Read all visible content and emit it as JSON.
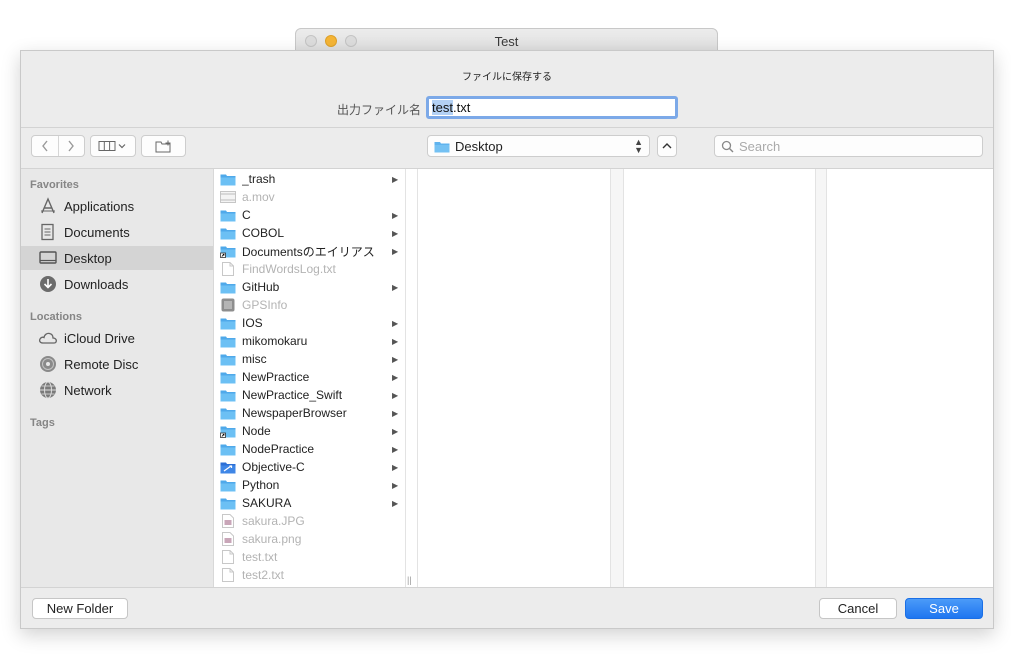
{
  "parent_window": {
    "title": "Test"
  },
  "sheet": {
    "message": "ファイルに保存する",
    "filename_label": "出力ファイル名",
    "filename_selected": "test",
    "filename_rest": ".txt"
  },
  "toolbar": {
    "location": "Desktop",
    "search_placeholder": "Search"
  },
  "sidebar": {
    "favorites_heading": "Favorites",
    "favorites": [
      {
        "label": "Applications",
        "icon": "applications-icon"
      },
      {
        "label": "Documents",
        "icon": "documents-icon"
      },
      {
        "label": "Desktop",
        "icon": "desktop-icon",
        "active": true
      },
      {
        "label": "Downloads",
        "icon": "downloads-icon"
      }
    ],
    "locations_heading": "Locations",
    "locations": [
      {
        "label": "iCloud Drive",
        "icon": "cloud-icon"
      },
      {
        "label": "Remote Disc",
        "icon": "disc-icon"
      },
      {
        "label": "Network",
        "icon": "network-icon"
      }
    ],
    "tags_heading": "Tags"
  },
  "files": [
    {
      "name": "_trash",
      "kind": "folder"
    },
    {
      "name": "a.mov",
      "kind": "movie",
      "dim": true
    },
    {
      "name": "C",
      "kind": "folder"
    },
    {
      "name": "COBOL",
      "kind": "folder"
    },
    {
      "name": "Documentsのエイリアス",
      "kind": "alias"
    },
    {
      "name": "FindWordsLog.txt",
      "kind": "text",
      "dim": true
    },
    {
      "name": "GitHub",
      "kind": "folder"
    },
    {
      "name": "GPSInfo",
      "kind": "app",
      "dim": true
    },
    {
      "name": "IOS",
      "kind": "folder"
    },
    {
      "name": "mikomokaru",
      "kind": "folder"
    },
    {
      "name": "misc",
      "kind": "folder"
    },
    {
      "name": "NewPractice",
      "kind": "folder"
    },
    {
      "name": "NewPractice_Swift",
      "kind": "folder"
    },
    {
      "name": "NewspaperBrowser",
      "kind": "folder"
    },
    {
      "name": "Node",
      "kind": "alias"
    },
    {
      "name": "NodePractice",
      "kind": "folder"
    },
    {
      "name": "Objective-C",
      "kind": "xcode"
    },
    {
      "name": "Python",
      "kind": "folder"
    },
    {
      "name": "SAKURA",
      "kind": "folder"
    },
    {
      "name": "sakura.JPG",
      "kind": "image",
      "dim": true
    },
    {
      "name": "sakura.png",
      "kind": "image",
      "dim": true
    },
    {
      "name": "test.txt",
      "kind": "text",
      "dim": true
    },
    {
      "name": "test2.txt",
      "kind": "text",
      "dim": true
    }
  ],
  "buttons": {
    "new_folder": "New Folder",
    "cancel": "Cancel",
    "save": "Save"
  },
  "colors": {
    "accent": "#1f76f0",
    "folder": "#5fb3ee"
  }
}
